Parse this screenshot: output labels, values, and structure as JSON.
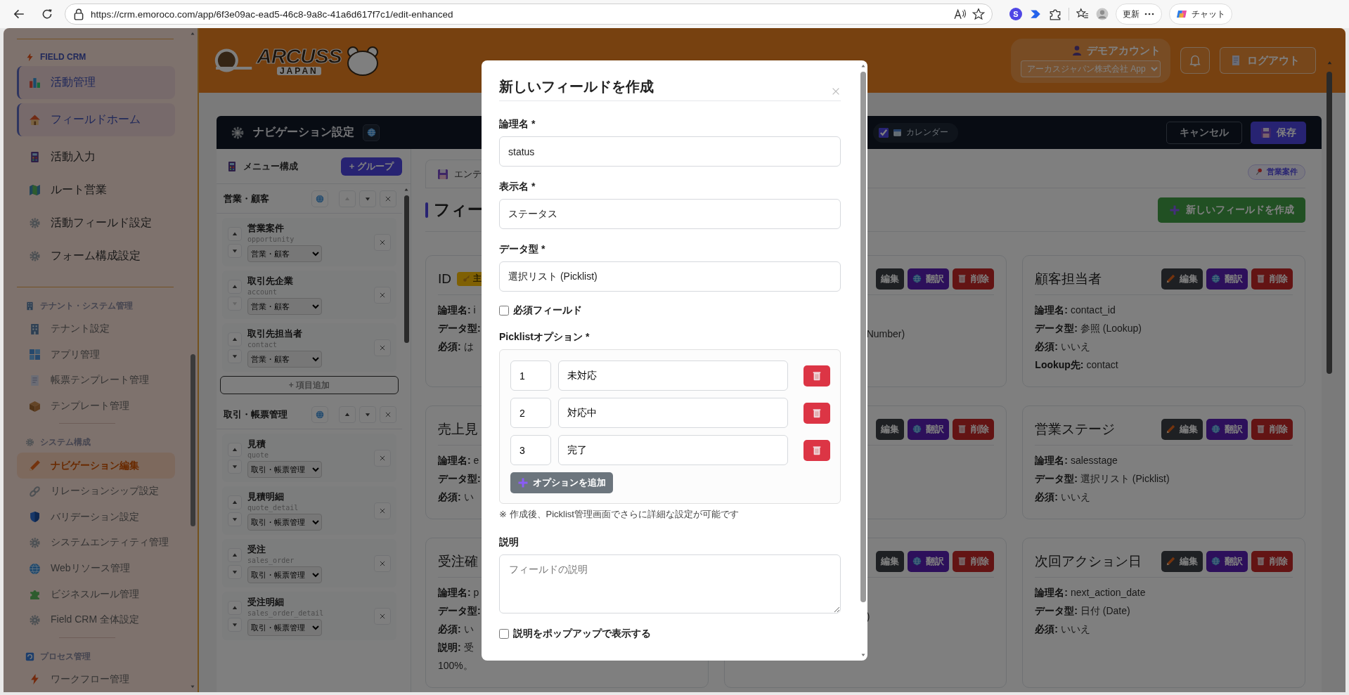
{
  "browser": {
    "url": "https://crm.emoroco.com/app/6f3e09ac-ead5-46c8-9a8c-41a6d617f7c1/edit-enhanced",
    "extension_letter": "S",
    "update_label": "更新",
    "chat_label": "チャット"
  },
  "sidebar": {
    "sections": [
      {
        "title": "FIELD CRM",
        "items": [
          {
            "label": "活動管理",
            "kind": "featured",
            "selected": false
          },
          {
            "label": "フィールドホーム",
            "kind": "featured",
            "selected": false
          },
          {
            "label": "活動入力",
            "kind": "link",
            "selected": false
          },
          {
            "label": "ルート営業",
            "kind": "link",
            "selected": false
          },
          {
            "label": "活動フィールド設定",
            "kind": "link",
            "selected": false
          },
          {
            "label": "フォーム構成設定",
            "kind": "link",
            "selected": false
          }
        ]
      },
      {
        "title": "テナント・システム管理",
        "items": [
          {
            "label": "テナント設定",
            "kind": "link",
            "selected": false
          },
          {
            "label": "アプリ管理",
            "kind": "link",
            "selected": false
          },
          {
            "label": "帳票テンプレート管理",
            "kind": "link",
            "selected": false
          },
          {
            "label": "テンプレート管理",
            "kind": "link",
            "selected": false
          }
        ]
      },
      {
        "title": "システム構成",
        "items": [
          {
            "label": "ナビゲーション編集",
            "kind": "link",
            "selected": true
          },
          {
            "label": "リレーションシップ設定",
            "kind": "link",
            "selected": false
          },
          {
            "label": "バリデーション設定",
            "kind": "link",
            "selected": false
          },
          {
            "label": "システムエンティティ管理",
            "kind": "link",
            "selected": false
          },
          {
            "label": "Webリソース管理",
            "kind": "link",
            "selected": false
          },
          {
            "label": "ビジネスルール管理",
            "kind": "link",
            "selected": false
          },
          {
            "label": "Field CRM 全体設定",
            "kind": "link",
            "selected": false
          }
        ]
      },
      {
        "title": "プロセス管理",
        "items": [
          {
            "label": "ワークフロー管理",
            "kind": "link",
            "selected": false
          }
        ]
      }
    ]
  },
  "header": {
    "logo_text": "ARCUSS",
    "logo_subtext": "JAPAN",
    "account_name": "デモアカウント",
    "company": "アーカスジャパン株式会社 App",
    "logout": "ログアウト"
  },
  "nav_bar": {
    "title": "ナビゲーション設定",
    "calendar": {
      "label": "カレンダー",
      "checked": true
    },
    "cancel": "キャンセル",
    "save": "保存"
  },
  "menu_panel": {
    "title": "メニュー構成",
    "add_group": "+ グループ",
    "groups": [
      {
        "name": "営業・顧客",
        "up_disabled": true,
        "items": [
          {
            "label": "営業案件",
            "code": "opportunity",
            "group": "営業・顧客",
            "down_disabled": false
          },
          {
            "label": "取引先企業",
            "code": "account",
            "group": "営業・顧客",
            "down_disabled": true
          },
          {
            "label": "取引先担当者",
            "code": "contact",
            "group": "営業・顧客",
            "down_disabled": false
          }
        ],
        "add_item": "+ 項目追加"
      },
      {
        "name": "取引・帳票管理",
        "up_disabled": false,
        "items": [
          {
            "label": "見積",
            "code": "quote",
            "group": "取引・帳票管理",
            "down_disabled": false
          },
          {
            "label": "見積明細",
            "code": "quote_detail",
            "group": "取引・帳票管理",
            "down_disabled": false
          },
          {
            "label": "受注",
            "code": "sales_order",
            "group": "取引・帳票管理",
            "down_disabled": false
          },
          {
            "label": "受注明細",
            "code": "sales_order_detail",
            "group": "取引・帳票管理",
            "down_disabled": false
          }
        ]
      }
    ]
  },
  "fields_area": {
    "tab": "エンテ",
    "entity_badge": "営業案件",
    "heading": "フィー",
    "create_button": "新しいフィールドを作成",
    "cards": [
      {
        "kind": "left_part",
        "title": "ID",
        "badge": "主",
        "lines": [
          {
            "label": "論理名:",
            "value": "i"
          },
          {
            "label": "データ型:"
          },
          {
            "label": "必須:",
            "value": "は"
          }
        ]
      },
      {
        "kind": "right_part",
        "buttons": [
          "編集",
          "翻訳",
          "削除"
        ],
        "lines": [
          {
            "value": "Number)"
          }
        ]
      },
      {
        "kind": "full",
        "title": "顧客担当者",
        "buttons": [
          "編集",
          "翻訳",
          "削除"
        ],
        "lines": [
          {
            "label": "論理名:",
            "value": "contact_id"
          },
          {
            "label": "データ型:",
            "value": "参照 (Lookup)"
          },
          {
            "label": "必須:",
            "value": "いいえ"
          },
          {
            "label": "Lookup先:",
            "value": "contact"
          }
        ]
      },
      {
        "kind": "left_part",
        "title": "売上見",
        "lines": [
          {
            "label": "論理名:",
            "value": "e"
          },
          {
            "label": "データ型:"
          },
          {
            "label": "必須:",
            "value": "い"
          }
        ]
      },
      {
        "kind": "right_part",
        "buttons": [
          "編集",
          "翻訳",
          "削除"
        ]
      },
      {
        "kind": "full",
        "title": "営業ステージ",
        "buttons": [
          "編集",
          "翻訳",
          "削除"
        ],
        "lines": [
          {
            "label": "論理名:",
            "value": "salesstage"
          },
          {
            "label": "データ型:",
            "value": "選択リスト (Picklist)"
          },
          {
            "label": "必須:",
            "value": "いいえ"
          }
        ]
      },
      {
        "kind": "left_part",
        "title": "受注確",
        "lines": [
          {
            "label": "論理名:",
            "value": "p"
          },
          {
            "label": "データ型:"
          },
          {
            "label": "必須:",
            "value": "い"
          },
          {
            "label": "説明:",
            "value": "受"
          },
          {
            "value": "100%。"
          }
        ]
      },
      {
        "kind": "right_part",
        "buttons": [
          "編集",
          "翻訳",
          "削除"
        ],
        "lines": [
          {
            "value": ")"
          }
        ]
      },
      {
        "kind": "full",
        "title": "次回アクション日",
        "buttons": [
          "編集",
          "翻訳",
          "削除"
        ],
        "lines": [
          {
            "label": "論理名:",
            "value": "next_action_date"
          },
          {
            "label": "データ型:",
            "value": "日付 (Date)"
          },
          {
            "label": "必須:",
            "value": "いいえ"
          }
        ]
      }
    ]
  },
  "modal": {
    "title": "新しいフィールドを作成",
    "fields": [
      {
        "label": "論理名 *",
        "value": "status"
      },
      {
        "label": "表示名 *",
        "value": "ステータス"
      },
      {
        "label": "データ型 *",
        "value": "選択リスト (Picklist)"
      }
    ],
    "required_checkbox": {
      "label": "必須フィールド",
      "checked": false
    },
    "picklist_label": "Picklistオプション *",
    "options": [
      {
        "value": "1",
        "label": "未対応"
      },
      {
        "value": "2",
        "label": "対応中"
      },
      {
        "value": "3",
        "label": "完了"
      }
    ],
    "add_option": "オプションを追加",
    "note": "※ 作成後、Picklist管理画面でさらに詳細な設定が可能です",
    "description_label": "説明",
    "description_placeholder": "フィールドの説明",
    "popup_checkbox": {
      "label": "説明をポップアップで表示する",
      "checked": false
    }
  }
}
